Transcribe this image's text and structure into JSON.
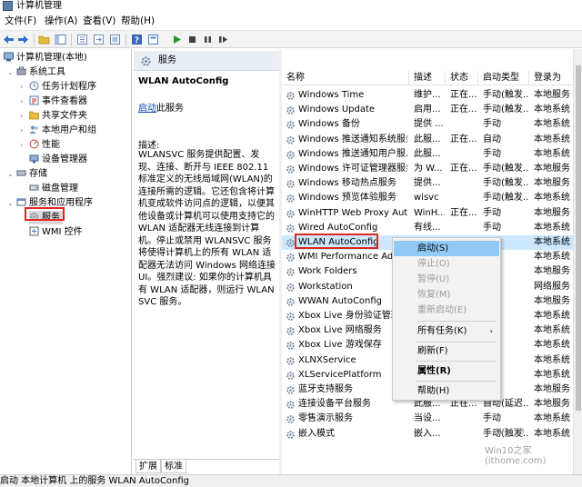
{
  "window": {
    "title": "计算机管理"
  },
  "menu": [
    "文件(F)",
    "操作(A)",
    "查看(V)",
    "帮助(H)"
  ],
  "toolbar": {
    "buttons": [
      {
        "name": "back-icon",
        "color": "#2c6fcf"
      },
      {
        "name": "forward-icon",
        "color": "#2c6fcf"
      },
      {
        "name": "up-folder-icon",
        "color": "#d9a21b"
      },
      {
        "name": "show-hide-tree-icon",
        "color": "#5c7fa8"
      },
      {
        "name": "refresh-icon",
        "color": "#6f8fb5"
      },
      {
        "name": "export-list-icon",
        "color": "#6f8fb5"
      },
      {
        "name": "help-icon",
        "color": "#3b63b9"
      },
      {
        "name": "properties-icon",
        "color": "#4d82c4"
      },
      {
        "name": "start-service-icon",
        "color": "#1f9a2e"
      },
      {
        "name": "stop-service-icon",
        "color": "#404040"
      },
      {
        "name": "pause-service-icon",
        "color": "#404040"
      },
      {
        "name": "restart-service-icon",
        "color": "#404040"
      }
    ]
  },
  "tree": {
    "root": "计算机管理(本地)",
    "system_tools": "系统工具",
    "task_scheduler": "任务计划程序",
    "event_viewer": "事件查看器",
    "shared_folders": "共享文件夹",
    "local_users_groups": "本地用户和组",
    "performance": "性能",
    "device_manager": "设备管理器",
    "storage": "存储",
    "disk_management": "磁盘管理",
    "services_apps": "服务和应用程序",
    "services": "服务",
    "wmi_control": "WMI 控件"
  },
  "detail": {
    "header": "服务",
    "service_name": "WLAN AutoConfig",
    "start_link": "启动",
    "start_link_suffix": "此服务",
    "desc_label": "描述:",
    "description": "WLANSVC 服务提供配置、发现、连接、断开与 IEEE 802.11 标准定义的无线局域网(WLAN)的连接所需的逻辑。它还包含将计算机变成软件访问点的逻辑，以便其他设备或计算机可以使用支持它的 WLAN 适配器无线连接到计算机。停止或禁用 WLANSVC 服务将使得计算机上的所有 WLAN 适配器无法访问 Windows 网络连接 UI。强烈建议: 如果你的计算机具有 WLAN 适配器，则运行 WLANSVC 服务。"
  },
  "tabs": [
    "扩展",
    "标准"
  ],
  "list": {
    "columns": [
      "名称",
      "描述",
      "状态",
      "启动类型",
      "登录为"
    ],
    "rows": [
      {
        "name": "Windows Time",
        "desc": "维护...",
        "status": "正在...",
        "startup": "手动(触发...",
        "logon": "本地服务"
      },
      {
        "name": "Windows Update",
        "desc": "启用...",
        "status": "正在...",
        "startup": "手动(触发...",
        "logon": "本地系统"
      },
      {
        "name": "Windows 备份",
        "desc": "提供 ...",
        "status": "",
        "startup": "手动",
        "logon": "本地系统"
      },
      {
        "name": "Windows 推送通知系统服务",
        "desc": "此服...",
        "status": "正在...",
        "startup": "自动",
        "logon": "本地系统"
      },
      {
        "name": "Windows 推送通知用户服...",
        "desc": "此服...",
        "status": "",
        "startup": "手动",
        "logon": "本地系统"
      },
      {
        "name": "Windows 许可证管理器服务",
        "desc": "为 W...",
        "status": "正在...",
        "startup": "手动(触发...",
        "logon": "本地服务"
      },
      {
        "name": "Windows 移动热点服务",
        "desc": "提供...",
        "status": "",
        "startup": "手动(触发...",
        "logon": "本地服务"
      },
      {
        "name": "Windows 预览体验服务",
        "desc": "wisvc",
        "status": "",
        "startup": "手动(触发...",
        "logon": "本地系统"
      },
      {
        "name": "WinHTTP Web Proxy Aut...",
        "desc": "WinH...",
        "status": "正在...",
        "startup": "手动",
        "logon": "本地服务"
      },
      {
        "name": "Wired AutoConfig",
        "desc": "有线...",
        "status": "",
        "startup": "手动",
        "logon": "本地系统"
      },
      {
        "name": "WLAN AutoConfig",
        "desc": "",
        "status": "",
        "startup": "",
        "logon": "本地系统"
      },
      {
        "name": "WMI Performance Ada",
        "desc": "",
        "status": "",
        "startup": "",
        "logon": "本地系统"
      },
      {
        "name": "Work Folders",
        "desc": "",
        "status": "",
        "startup": "",
        "logon": "本地服务"
      },
      {
        "name": "Workstation",
        "desc": "",
        "status": "",
        "startup": "",
        "logon": "网络服务"
      },
      {
        "name": "WWAN AutoConfig",
        "desc": "",
        "status": "",
        "startup": "",
        "logon": "本地服务"
      },
      {
        "name": "Xbox Live 身份验证管理",
        "desc": "",
        "status": "",
        "startup": "",
        "logon": "本地系统"
      },
      {
        "name": "Xbox Live 网络服务",
        "desc": "",
        "status": "",
        "startup": "",
        "logon": "本地系统"
      },
      {
        "name": "Xbox Live 游戏保存",
        "desc": "",
        "status": "",
        "startup": "",
        "logon": "本地系统"
      },
      {
        "name": "XLNXService",
        "desc": "",
        "status": "",
        "startup": "",
        "logon": "本地系统"
      },
      {
        "name": "XLServicePlatform",
        "desc": "",
        "status": "",
        "startup": "",
        "logon": "本地系统"
      },
      {
        "name": "蓝牙支持服务",
        "desc": "",
        "status": "",
        "startup": "",
        "logon": "本地服务"
      },
      {
        "name": "连接设备平台服务",
        "desc": "此服...",
        "status": "正在...",
        "startup": "自动(延迟...",
        "logon": "本地服务"
      },
      {
        "name": "零售演示服务",
        "desc": "当设...",
        "status": "",
        "startup": "手动",
        "logon": "本地系统"
      },
      {
        "name": "嵌入模式",
        "desc": "嵌入...",
        "status": "",
        "startup": "手动(触发...",
        "logon": "本地系统"
      }
    ]
  },
  "context_menu": {
    "start": "启动(S)",
    "stop": "停止(O)",
    "pause": "暂停(U)",
    "resume": "恢复(M)",
    "restart": "重新启动(E)",
    "all_tasks": "所有任务(K)",
    "refresh": "刷新(F)",
    "properties": "属性(R)",
    "help": "帮助(H)"
  },
  "status_bar": "启动 本地计算机 上的服务 WLAN AutoConfig",
  "watermark": {
    "line1": "Win10",
    "line2": "Win10之家(ithome.com)"
  },
  "colors": {
    "selected_row": "#cce8ff",
    "menu_highlight": "#91c9f7",
    "annotation_box": "#e32420",
    "link": "#0645ad",
    "gear": "#7a8ea6"
  }
}
